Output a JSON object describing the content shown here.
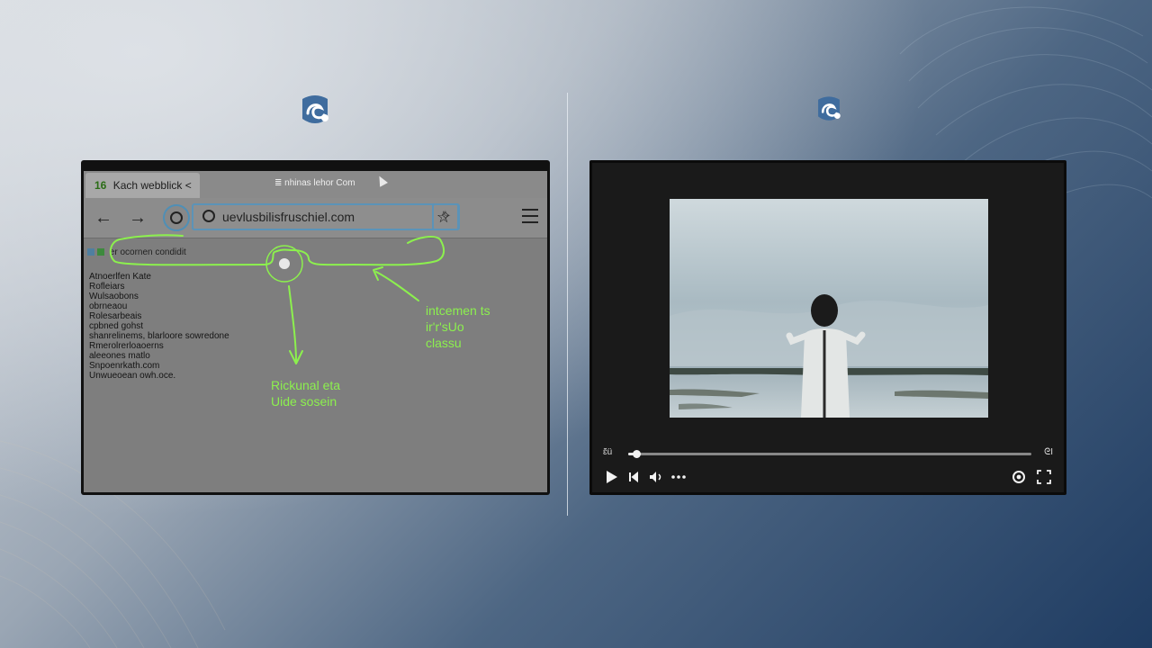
{
  "colors": {
    "annotation": "#8cf04e",
    "accent_blue": "#5b93b8",
    "logo_blue": "#3f6c9e"
  },
  "left_logo": {
    "icon": "app-logo-icon"
  },
  "right_logo": {
    "icon": "app-logo-icon"
  },
  "browser": {
    "tab": {
      "favicon_text": "16",
      "title": "Kach webblick <"
    },
    "tab_context": "≣ nhinas lehor Com",
    "url": "uevlusbilisfruschiel.com",
    "icons": {
      "back": "arrow-left-icon",
      "forward": "arrow-right-icon",
      "shield": "shield-icon",
      "star": "star-icon",
      "extension": "puzzle-icon",
      "menu": "hamburger-menu-icon"
    },
    "bookmark_bar": "er ocornen condidit",
    "links": [
      "Atnoerlfen Kate",
      "Rofleiars",
      "Wulsaobons",
      "obrneaou",
      "Rolesarbeais",
      "cpbned gohst",
      "shanrelinems,  blarloore sowredone",
      "Rmerolrerloaoerns",
      "aleeones matlo",
      "Snpoenrkath.com",
      "Unwueoean owh.oce."
    ],
    "annotations": {
      "right": [
        "intcemen ts",
        "ir'r'sUo",
        "classu"
      ],
      "bottom": [
        "Rickunal eta",
        "Uide sosein"
      ]
    }
  },
  "video": {
    "progress_fraction": 0.02,
    "time_left": "ɛ̃ü",
    "time_right": "ᘓI",
    "icons": {
      "play": "play-icon",
      "skip": "skip-icon",
      "volume": "volume-icon",
      "more": "more-dots-icon",
      "settings": "settings-icon",
      "fullscreen": "fullscreen-icon"
    }
  }
}
